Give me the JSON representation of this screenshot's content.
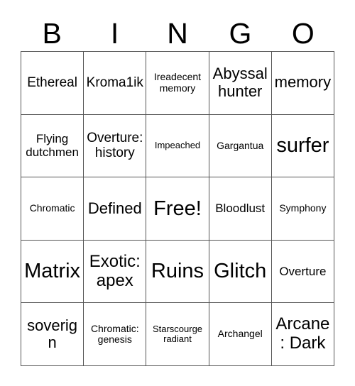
{
  "card": {
    "header_letters": [
      "B",
      "I",
      "N",
      "G",
      "O"
    ],
    "columns": 5,
    "rows": 5,
    "colors": {
      "background": "#ffffff",
      "text": "#000000",
      "grid_line": "#555555"
    },
    "cells": [
      {
        "text": "Ethereal",
        "size": "fs-s"
      },
      {
        "text": "Kroma1ik",
        "size": "fs-s"
      },
      {
        "text": "Ireadecent memory",
        "size": "fs-xxs"
      },
      {
        "text": "Abyssal hunter",
        "size": "fs-m"
      },
      {
        "text": "memory",
        "size": "fs-m"
      },
      {
        "text": "Flying dutchmen",
        "size": "fs-xs"
      },
      {
        "text": "Overture: history",
        "size": "fs-s"
      },
      {
        "text": "Impeached",
        "size": "fs-tiny"
      },
      {
        "text": "Gargantua",
        "size": "fs-xxs"
      },
      {
        "text": "surfer",
        "size": "fs-xxl"
      },
      {
        "text": "Chromatic",
        "size": "fs-xxs"
      },
      {
        "text": "Defined",
        "size": "fs-m"
      },
      {
        "text": "Free!",
        "size": "fs-xxl"
      },
      {
        "text": "Bloodlust",
        "size": "fs-xs"
      },
      {
        "text": "Symphony",
        "size": "fs-xxs"
      },
      {
        "text": "Matrix",
        "size": "fs-xxl"
      },
      {
        "text": "Exotic: apex",
        "size": "fs-l"
      },
      {
        "text": "Ruins",
        "size": "fs-xxl"
      },
      {
        "text": "Glitch",
        "size": "fs-xxl"
      },
      {
        "text": "Overture",
        "size": "fs-xs"
      },
      {
        "text": "soverign",
        "size": "fs-m"
      },
      {
        "text": "Chromatic: genesis",
        "size": "fs-xxs"
      },
      {
        "text": "Starscourge radiant",
        "size": "fs-tiny"
      },
      {
        "text": "Archangel",
        "size": "fs-xxs"
      },
      {
        "text": "Arcane: Dark",
        "size": "fs-l"
      }
    ]
  }
}
